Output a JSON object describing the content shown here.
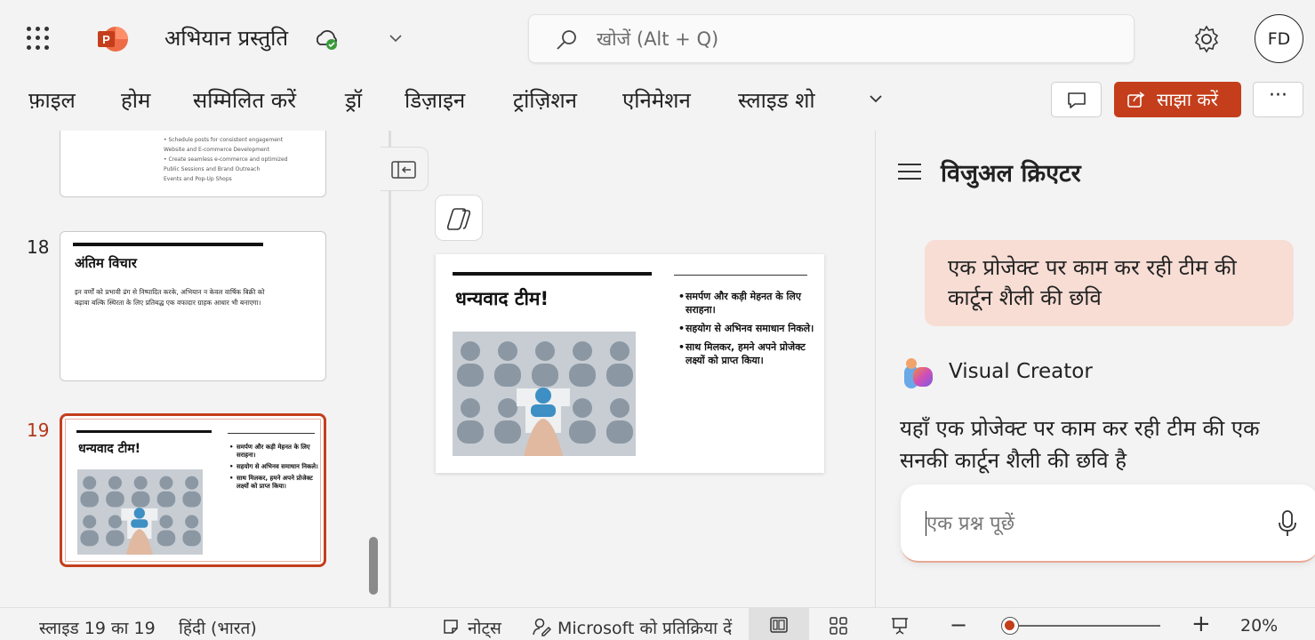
{
  "app": {
    "doc_title": "अभियान प्रस्तुति",
    "search_placeholder": "खोजें (Alt + Q)",
    "user_initials": "FD"
  },
  "ribbon": {
    "tabs": [
      "फ़ाइल",
      "होम",
      "सम्मिलित करें",
      "ड्रॉ",
      "डिज़ाइन",
      "ट्रांज़िशन",
      "एनिमेशन",
      "स्लाइड शो"
    ],
    "share_label": "साझा करें",
    "more_label": "···"
  },
  "thumbnails": {
    "slide17_lines": [
      "•  Schedule posts for consistent engagement",
      "Website and E-commerce Development",
      "•  Create seamless e-commerce and optimized",
      "Public Sessions and Brand Outreach",
      "Events and Pop-Up Shops"
    ],
    "slide18": {
      "number": "18",
      "title": "अंतिम विचार",
      "body": "इन वर्णों को प्रभावी ढंग से निष्पादित करके, अभियान न केवल वार्षिक बिक्री को बढ़ावा बल्कि स्थिरता के लिए प्रतिबद्ध एक वफादार ग्राहक आधार भी बनाएगा।"
    },
    "slide19": {
      "number": "19"
    }
  },
  "slide": {
    "title": "धन्यवाद टीम!",
    "bullets": [
      "समर्पण और कड़ी मेहनत के लिए सराहना।",
      "सहयोग से अभिनव समाधान निकले।",
      "साथ मिलकर, हमने अपने प्रोजेक्ट लक्ष्यों को प्राप्त किया।"
    ]
  },
  "panel": {
    "title": "विजुअल क्रिएटर",
    "user_message": "एक प्रोजेक्ट पर काम कर रही टीम की कार्टून शैली की छवि",
    "bot_name": "Visual Creator",
    "bot_message": "यहाँ एक प्रोजेक्ट पर काम कर रही टीम की एक सनकी कार्टून शैली की छवि है",
    "ask_placeholder": "एक प्रश्न पूछें"
  },
  "status": {
    "slide_counter": "स्लाइड 19 का 19",
    "language": "हिंदी (भारत)",
    "notes": "नोट्स",
    "feedback": "Microsoft को प्रतिक्रिया दें",
    "zoom_minus": "−",
    "zoom_plus": "+",
    "zoom": "20%",
    "zoom_fraction": 0.05
  },
  "colors": {
    "accent": "#c43e1c",
    "user_bubble": "#f7ddd4"
  }
}
